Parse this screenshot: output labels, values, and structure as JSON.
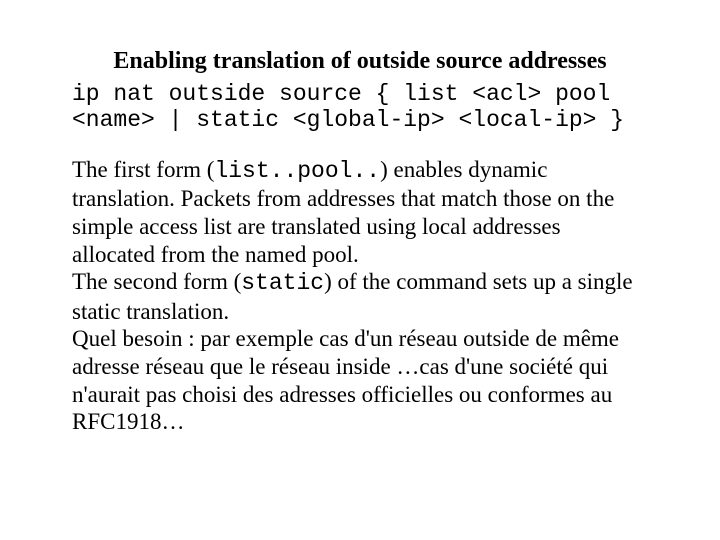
{
  "title": "Enabling translation of outside source addresses",
  "syntax": "ip nat outside source { list <acl> pool <name> | static <global-ip> <local-ip> }",
  "para1": {
    "lead": "The first form (",
    "code": "list..pool..",
    "tail": ") enables dynamic translation. Packets from addresses that match those on the simple access list are translated using local addresses allocated from the named pool."
  },
  "para2": {
    "lead": "The second form (",
    "code": "static",
    "tail": ") of the command sets up a single static translation."
  },
  "para3": "Quel besoin : par exemple cas d'un réseau outside de même adresse réseau que le réseau inside …cas d'une société qui n'aurait pas choisi des adresses officielles ou conformes au RFC1918…"
}
